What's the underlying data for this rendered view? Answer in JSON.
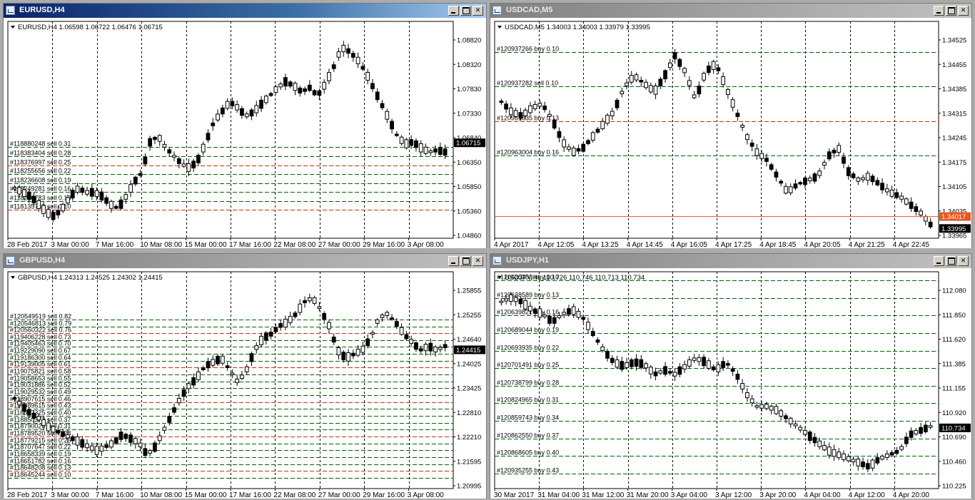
{
  "windows": [
    {
      "key": "eurusd",
      "title": "EURUSD,H4",
      "active": true,
      "header": "EURUSD,H4  1.06598 1.06722 1.06476 1.06715",
      "price_scale": [
        "1.08820",
        "1.08320",
        "1.07830",
        "1.07330",
        "1.06840",
        "1.06350",
        "1.05850",
        "1.05360",
        "1.04860"
      ],
      "current_price": "1.06715",
      "current_color": "#000000",
      "time_labels": [
        "28 Feb 2017",
        "3 Mar 00:00",
        "7 Mar 16:00",
        "10 Mar 08:00",
        "15 Mar 00:00",
        "17 Mar 16:00",
        "22 Mar 08:00",
        "27 Mar 00:00",
        "29 Mar 16:00",
        "3 Apr 08:00"
      ],
      "orders": [
        "#118880248 sell 0.31",
        "#118383404 sell 0.28",
        "#118376997 sell 0.25",
        "#118255656 sell 0.22",
        "#118236608 sell 0.19",
        "#118249281 sell 0.16",
        "#118210783 sell 0.13",
        "#118135740 sell 0.10"
      ]
    },
    {
      "key": "usdcad",
      "title": "USDCAD,M5",
      "active": false,
      "header": "USDCAD,M5  1.34003 1.34003 1.33979 1.33995",
      "price_scale": [
        "1.34525",
        "1.34455",
        "1.34385",
        "1.34315",
        "1.34245",
        "1.34175",
        "1.34105",
        "1.34035",
        "1.33965"
      ],
      "current_price": "1.33995",
      "current_color": "#000000",
      "bid_price": "1.34017",
      "bid_color": "#e8571e",
      "time_labels": [
        "4 Apr 2017",
        "4 Apr 12:05",
        "4 Apr 13:25",
        "4 Apr 14:45",
        "4 Apr 16:05",
        "4 Apr 17:25",
        "4 Apr 18:45",
        "4 Apr 20:05",
        "4 Apr 21:25",
        "4 Apr 22:45"
      ],
      "orders": [
        "#120937266 buy 0.10",
        "#120937282 sell 0.10",
        "#120951835 buy 0.13",
        "#120963004 buy 0.16"
      ]
    },
    {
      "key": "gbpusd",
      "title": "GBPUSD,H4",
      "active": false,
      "header": "GBPUSD,H4  1.24313 1.24525 1.24302 1.24415",
      "price_scale": [
        "1.25855",
        "1.25255",
        "1.24640",
        "1.24025",
        "1.23425",
        "1.22810",
        "1.22210",
        "1.21595",
        "1.20995"
      ],
      "current_price": "1.24415",
      "current_color": "#000000",
      "time_labels": [
        "28 Feb 2017",
        "3 Mar 00:00",
        "7 Mar 16:00",
        "10 Mar 08:00",
        "15 Mar 00:00",
        "17 Mar 16:00",
        "22 Mar 08:00",
        "27 Mar 00:00",
        "29 Mar 16:00",
        "3 Apr 08:00"
      ],
      "orders": [
        "#120549519 sell 0.82",
        "#120546813 sell 0.79",
        "#120560322 sell 0.76",
        "#119406228 sell 0.73",
        "#119405463 sell 0.70",
        "#119229090 sell 0.67",
        "#119186300 sell 0.64",
        "#119139005 sell 0.61",
        "#119075821 sell 0.58",
        "#119058653 sell 0.55",
        "#119031886 sell 0.52",
        "#119029532 sell 0.49",
        "#118907615 sell 0.46",
        "#118889615 sell 0.43",
        "#118867325 sell 0.40",
        "#118850373 sell 0.37",
        "#118790020 sell 0.31",
        "#118789520 sell 0.28",
        "#118779215 sell 0.25",
        "#118707647 sell 0.22",
        "#118658339 sell 0.19",
        "#118651782 sell 0.16",
        "#118648208 sell 0.13",
        "#118645244 sell 0.10"
      ]
    },
    {
      "key": "usdjpy",
      "title": "USDJPY,H1",
      "active": false,
      "header": "USDJPY,H1  110.726 110.746 110.713 110.734",
      "price_scale": [
        "112.080",
        "111.850",
        "111.620",
        "111.385",
        "111.155",
        "110.920",
        "110.690",
        "110.460",
        "110.225"
      ],
      "current_price": "110.734",
      "current_color": "#000000",
      "time_labels": [
        "30 Mar 2017",
        "31 Mar 04:00",
        "31 Mar 12:00",
        "31 Mar 20:00",
        "3 Apr 04:00",
        "3 Apr 12:00",
        "3 Apr 20:00",
        "4 Apr 04:00",
        "4 Apr 12:00",
        "4 Apr 20:00"
      ],
      "orders": [
        "#120635353 buy 0.10",
        "#120638589 buy 0.13",
        "#120639821 buy 0.16",
        "#120689044 buy 0.19",
        "#120693935 buy 0.22",
        "#120701491 buy 0.25",
        "#120738799 buy 0.28",
        "#120824965 buy 0.31",
        "#120859743 buy 0.34",
        "#120862550 buy 0.37",
        "#120868605 buy 0.40",
        "#120935255 buy 0.43"
      ]
    }
  ],
  "colors": {
    "order_line": "#006400",
    "sell_limit_line": "#c83200",
    "candle": "#000000",
    "grid": "#000000"
  },
  "icons": {
    "window": "chart-window-icon",
    "minimize": "minimize-icon",
    "restore": "restore-icon",
    "close": "close-icon",
    "dropdown": "triangle-down-icon"
  }
}
